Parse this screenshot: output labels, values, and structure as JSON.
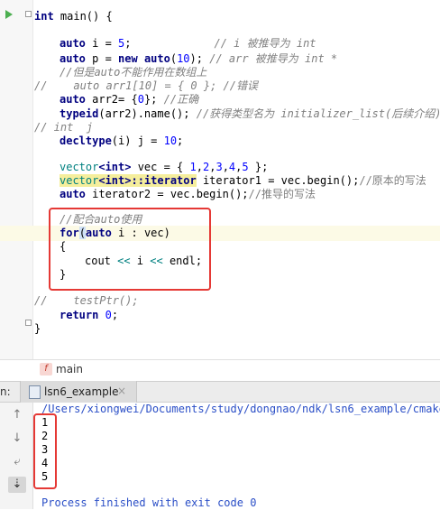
{
  "editor": {
    "lines": {
      "l1": {
        "kw": "int",
        "rest": " main() {"
      },
      "l3": {
        "kw": "auto",
        "name": " i = ",
        "num": "5",
        "semi": ";",
        "cmt": "// i 被推导为 int"
      },
      "l4": {
        "kw": "auto",
        "name": " p = ",
        "kw2": "new",
        "kw3": " auto",
        "paren": "(",
        "num": "10",
        "close": "); ",
        "cmt": "// arr 被推导为 int *"
      },
      "l5": {
        "cmt": "//但是auto不能作用在数组上"
      },
      "l6": {
        "cmt": "//    auto arr1[10] = { 0 }; //错误"
      },
      "l7": {
        "kw": "auto",
        "name": " arr2= {",
        "num": "0",
        "close": "}; ",
        "cmt": "//正确"
      },
      "l8": {
        "kw": "typeid",
        "rest": "(arr2).name(); ",
        "cmt": "//获得类型名为 initializer_list(后续介绍)"
      },
      "l9": {
        "cmt": "// int  j"
      },
      "l10": {
        "kw": "decltype",
        "rest": "(i) j = ",
        "num": "10",
        "semi": ";"
      },
      "l12": {
        "typ": "vector",
        "tmpl": "<int>",
        "rest": " vec = { ",
        "n1": "1",
        "c1": ",",
        "n2": "2",
        "c2": ",",
        "n3": "3",
        "c3": ",",
        "n4": "4",
        "c4": ",",
        "n5": "5",
        "end": " };"
      },
      "l13": {
        "typ": "vector",
        "tmpl": "<int>::iterator",
        "rest": " iterator1 = vec.begin();",
        "cmt": "//原本的写法"
      },
      "l14": {
        "kw": "auto",
        "rest": " iterator2 = vec.begin();",
        "cmt": "//推导的写法"
      },
      "l16": {
        "cmt": "//配合auto使用"
      },
      "l17": {
        "kw": "for",
        "paren": "(",
        "kw2": "auto",
        "rest": " i : vec)"
      },
      "l18": {
        "text": "{"
      },
      "l19": {
        "a": "cout ",
        "op1": "<<",
        "b": " i ",
        "op2": "<<",
        "c": " endl;"
      },
      "l20": {
        "text": "}"
      },
      "l22": {
        "cmt": "//    testPtr();"
      },
      "l23": {
        "kw": "return",
        "sp": " ",
        "num": "0",
        "semi": ";"
      },
      "l24": {
        "text": "}"
      }
    }
  },
  "breadcrumb": {
    "icon_letter": "f",
    "label": "main"
  },
  "run_panel": {
    "prefix": "n:",
    "tab_label": "lsn6_example",
    "tab_close": "×",
    "path": "/Users/xiongwei/Documents/study/dongnao/ndk/lsn6_example/cmake-",
    "outputs": [
      "1",
      "2",
      "3",
      "4",
      "5"
    ],
    "finished": "Process finished with exit code 0",
    "tools": {
      "up": "↑",
      "down": "↓",
      "wrap": "⤶",
      "scroll": "⇣"
    }
  },
  "colors": {
    "highlight_box": "#e53935",
    "keyword": "#000080",
    "number": "#0000ff",
    "comment": "#808080",
    "console_text": "#2b4fc7"
  }
}
